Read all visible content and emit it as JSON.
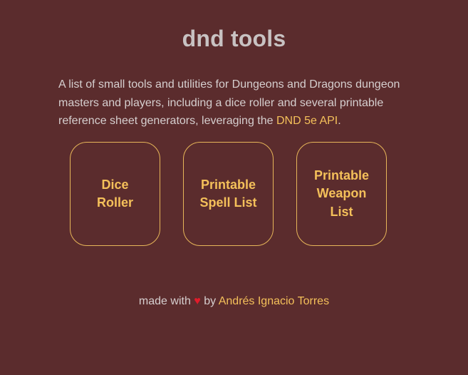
{
  "page": {
    "title": "dnd tools"
  },
  "intro": {
    "text_before_link": "A list of small tools and utilities for Dungeons and Dragons dungeon masters and players, including a dice roller and several printable reference sheet generators, leveraging the ",
    "link_text": "DND 5e API",
    "text_after_link": "."
  },
  "tools": [
    {
      "label": "Dice Roller"
    },
    {
      "label": "Printable Spell List"
    },
    {
      "label": "Printable Weapon List"
    }
  ],
  "footer": {
    "made_with": "made with",
    "heart": "♥",
    "by": "by",
    "author_link": "Andrés Ignacio Torres"
  },
  "colors": {
    "background": "#5b2c2d",
    "accent": "#f4c05a",
    "border": "#e7b659",
    "heart": "#e21b2a",
    "text": "#d6cfcf"
  }
}
